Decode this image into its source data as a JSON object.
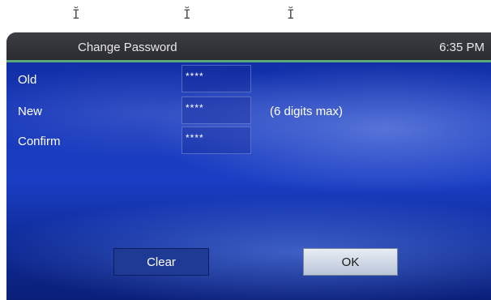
{
  "cursors": [
    "Ĭ",
    "Ĭ",
    "Ĭ"
  ],
  "titlebar": {
    "title": "Change Password",
    "clock": "6:35 PM"
  },
  "form": {
    "fields": [
      {
        "label": "Old",
        "value": "****"
      },
      {
        "label": "New",
        "value": "****"
      },
      {
        "label": "Confirm",
        "value": "****"
      }
    ],
    "hint": "(6 digits max)"
  },
  "buttons": {
    "clear": "Clear",
    "ok": "OK"
  },
  "colors": {
    "background": "#1a3ec4",
    "titlebar": "#2a2c31",
    "titlebar_accent": "#5aa87a"
  }
}
